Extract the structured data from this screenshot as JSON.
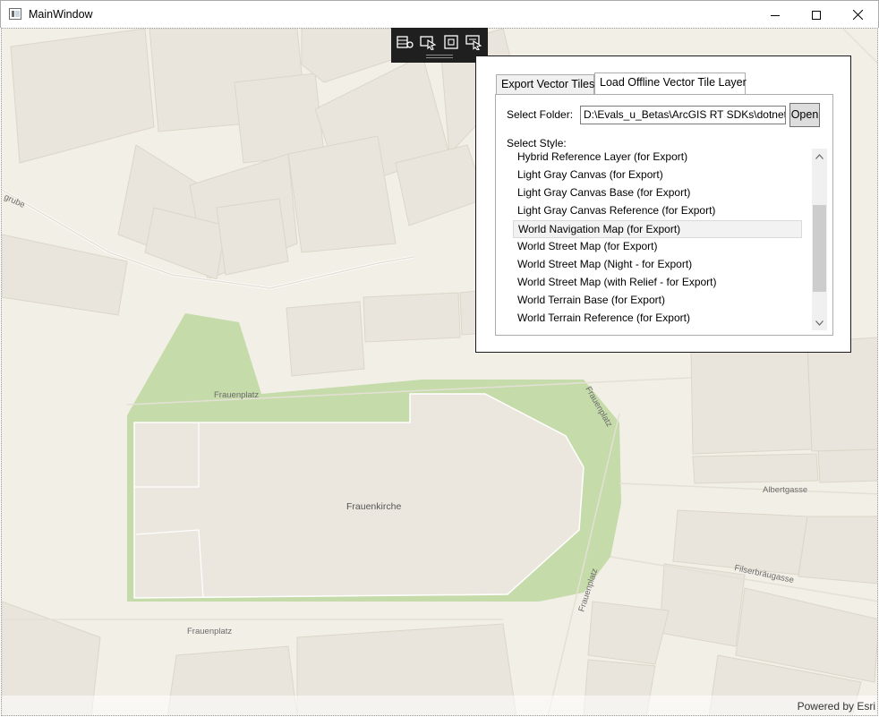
{
  "window": {
    "title": "MainWindow",
    "controls": [
      "minimize-icon",
      "maximize-icon",
      "close-icon"
    ]
  },
  "map": {
    "labels": {
      "frauenplatz_top": "Frauenplatz",
      "frauenplatz_right": "Frauenplatz",
      "frauenkirche": "Frauenkirche",
      "albertgasse": "Albertgasse",
      "filserbraeugasse": "Filserbräugasse",
      "frauenplatz_lower_right": "Frauenplatz",
      "frauenplatz_bottom": "Frauenplatz",
      "grube": "grube"
    },
    "attribution": "Powered by Esri",
    "colors": {
      "background": "#f2efe6",
      "building": "#e9e5dc",
      "green": "#c5dbaa",
      "road": "#ffffff"
    }
  },
  "toolbar": {
    "tools": [
      "edit-table-icon",
      "select-cursor-icon",
      "frame-icon",
      "multi-select-icon"
    ]
  },
  "panel": {
    "tabs": [
      {
        "label": "Export Vector Tiles",
        "active": false
      },
      {
        "label": "Load Offline Vector Tile Layer",
        "active": true
      }
    ],
    "select_folder_label": "Select Folder:",
    "folder_value": "D:\\Evals_u_Betas\\ArcGIS RT SDKs\\dotnet\\Q",
    "open_label": "Open",
    "select_style_label": "Select Style:",
    "styles": [
      "Hybrid Reference Layer (for Export)",
      "Light Gray Canvas (for Export)",
      "Light Gray Canvas Base (for Export)",
      "Light Gray Canvas Reference (for Export)",
      "World Navigation Map (for Export)",
      "World Street Map (for Export)",
      "World Street Map (Night - for Export)",
      "World Street Map (with Relief - for Export)",
      "World Terrain Base (for Export)",
      "World Terrain Reference (for Export)"
    ],
    "selected_style": "World Navigation Map (for Export)"
  }
}
